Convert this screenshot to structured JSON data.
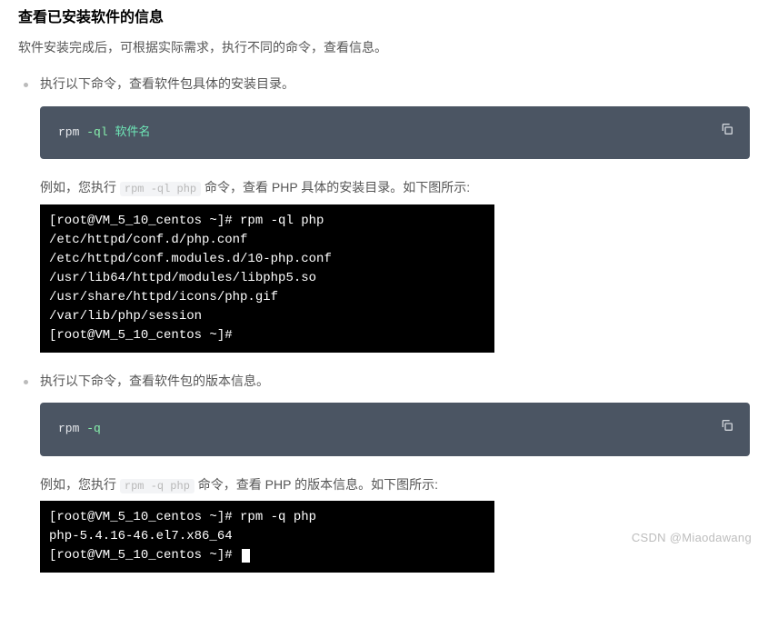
{
  "heading": "查看已安装软件的信息",
  "intro": "软件安装完成后，可根据实际需求，执行不同的命令，查看信息。",
  "items": [
    {
      "lead": "执行以下命令，查看软件包具体的安装目录。",
      "code": {
        "cmd": "rpm",
        "flag": "-ql",
        "arg": "软件名"
      },
      "example_prefix": "例如，您执行 ",
      "example_inline": "rpm -ql php",
      "example_suffix": " 命令，查看 PHP 具体的安装目录。如下图所示:",
      "terminal": "[root@VM_5_10_centos ~]# rpm -ql php\n/etc/httpd/conf.d/php.conf\n/etc/httpd/conf.modules.d/10-php.conf\n/usr/lib64/httpd/modules/libphp5.so\n/usr/share/httpd/icons/php.gif\n/var/lib/php/session\n[root@VM_5_10_centos ~]#"
    },
    {
      "lead": "执行以下命令，查看软件包的版本信息。",
      "code": {
        "cmd": "rpm",
        "flag": "-q",
        "arg": ""
      },
      "example_prefix": "例如，您执行 ",
      "example_inline": "rpm -q php",
      "example_suffix": " 命令，查看 PHP 的版本信息。如下图所示:",
      "terminal": "[root@VM_5_10_centos ~]# rpm -q php\nphp-5.4.16-46.el7.x86_64\n[root@VM_5_10_centos ~]# "
    }
  ],
  "watermark": "CSDN @Miaodawang"
}
